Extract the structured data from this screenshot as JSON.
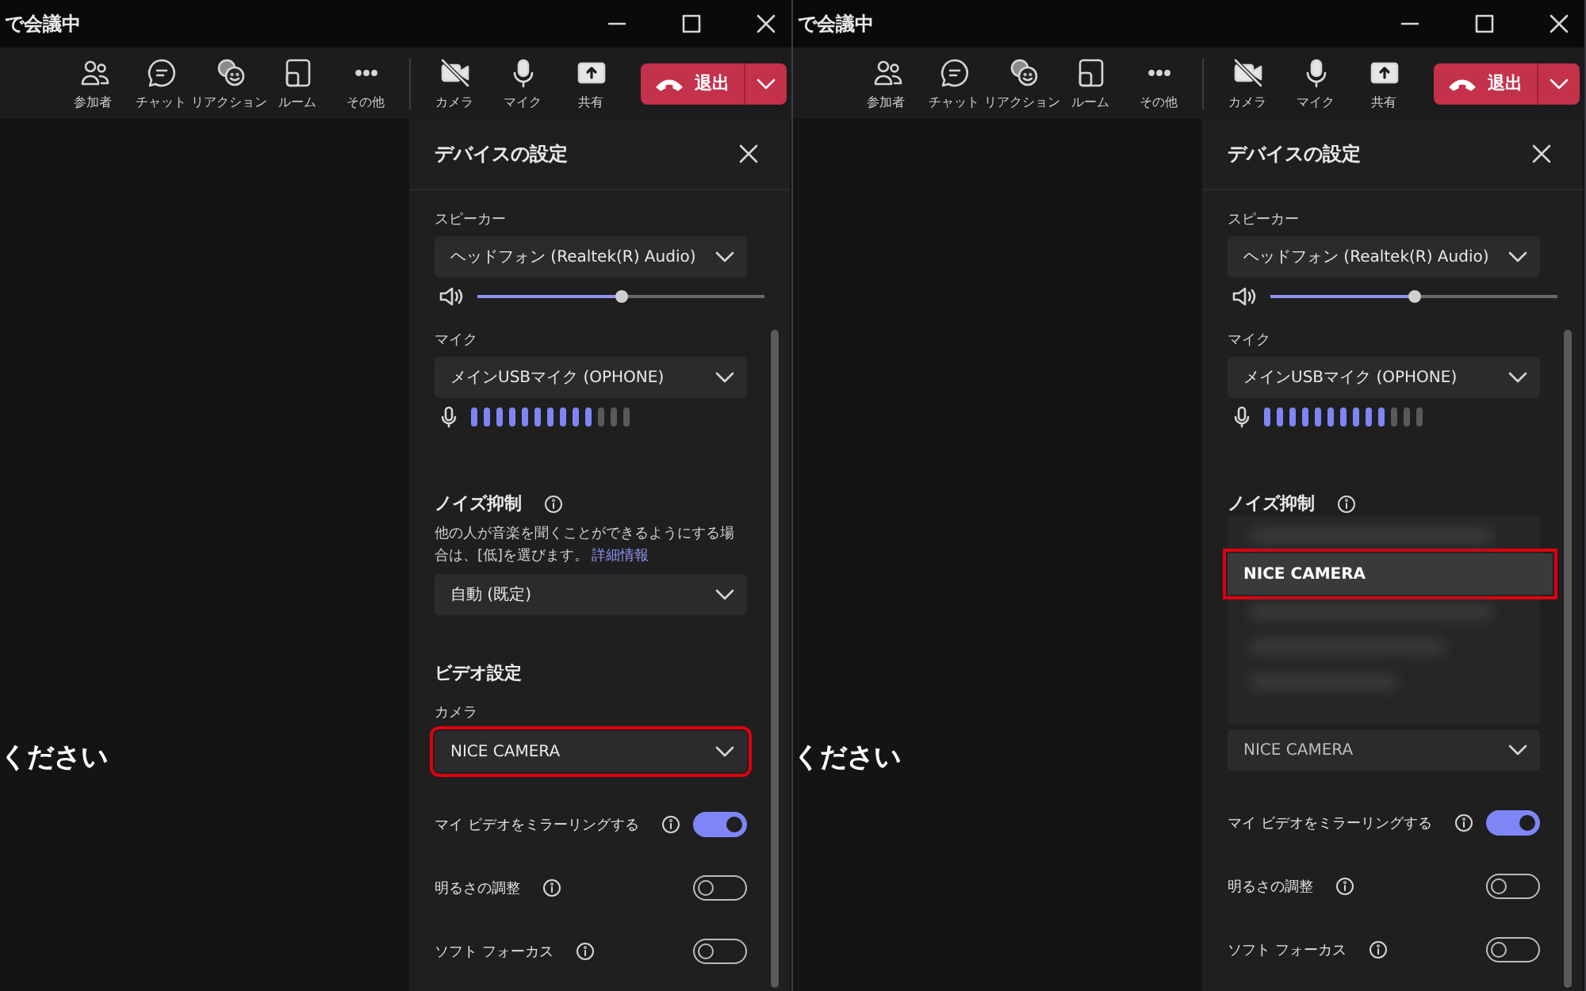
{
  "panes": [
    {
      "window": {
        "title": "で会議中"
      },
      "toolbar": {
        "items": [
          {
            "kind": "people",
            "label": "参加者"
          },
          {
            "kind": "chat",
            "label": "チャット"
          },
          {
            "kind": "reaction",
            "label": "リアクション"
          },
          {
            "kind": "room",
            "label": "ルーム"
          },
          {
            "kind": "more",
            "label": "その他"
          },
          {
            "kind": "camera",
            "label": "カメラ"
          },
          {
            "kind": "mic",
            "label": "マイク"
          },
          {
            "kind": "share",
            "label": "共有"
          }
        ],
        "leave": {
          "label": "退出"
        }
      },
      "stage": {
        "text": "ください"
      },
      "panel": {
        "title": "デバイスの設定",
        "speaker": {
          "label": "スピーカー",
          "value": "ヘッドフォン (Realtek(R) Audio)",
          "level": 0.5
        },
        "mic": {
          "label": "マイク",
          "value": "メインUSBマイク (OPHONE)",
          "level": 0.77
        },
        "noise": {
          "heading": "ノイズ抑制",
          "description": "他の人が音楽を聞くことができるようにする場合は、[低]を選びます。",
          "link": "詳細情報",
          "value": "自動 (既定)"
        },
        "video": {
          "heading": "ビデオ設定",
          "camera_label": "カメラ",
          "camera_value": "NICE CAMERA",
          "highlighted": true
        },
        "toggles": [
          {
            "label": "マイ ビデオをミラーリングする",
            "on": true
          },
          {
            "label": "明るさの調整",
            "on": false
          },
          {
            "label": "ソフト フォーカス",
            "on": false
          }
        ]
      }
    },
    {
      "window": {
        "title": "で会議中"
      },
      "toolbar": {
        "items": [
          {
            "kind": "people",
            "label": "参加者"
          },
          {
            "kind": "chat",
            "label": "チャット"
          },
          {
            "kind": "reaction",
            "label": "リアクション"
          },
          {
            "kind": "room",
            "label": "ルーム"
          },
          {
            "kind": "more",
            "label": "その他"
          },
          {
            "kind": "camera",
            "label": "カメラ"
          },
          {
            "kind": "mic",
            "label": "マイク"
          },
          {
            "kind": "share",
            "label": "共有"
          }
        ],
        "leave": {
          "label": "退出"
        }
      },
      "stage": {
        "text": "ください"
      },
      "panel": {
        "title": "デバイスの設定",
        "speaker": {
          "label": "スピーカー",
          "value": "ヘッドフォン (Realtek(R) Audio)",
          "level": 0.5
        },
        "mic": {
          "label": "マイク",
          "value": "メインUSBマイク (OPHONE)",
          "level": 0.77
        },
        "noise": {
          "heading": "ノイズ抑制"
        },
        "camera_menu": {
          "options": [
            {
              "label": "NICE CAMERA",
              "selected": true,
              "highlighted": true
            }
          ]
        },
        "video": {
          "camera_value": "NICE CAMERA",
          "highlighted": false
        },
        "toggles": [
          {
            "label": "マイ ビデオをミラーリングする",
            "on": true
          },
          {
            "label": "明るさの調整",
            "on": false
          },
          {
            "label": "ソフト フォーカス",
            "on": false
          }
        ]
      }
    }
  ]
}
